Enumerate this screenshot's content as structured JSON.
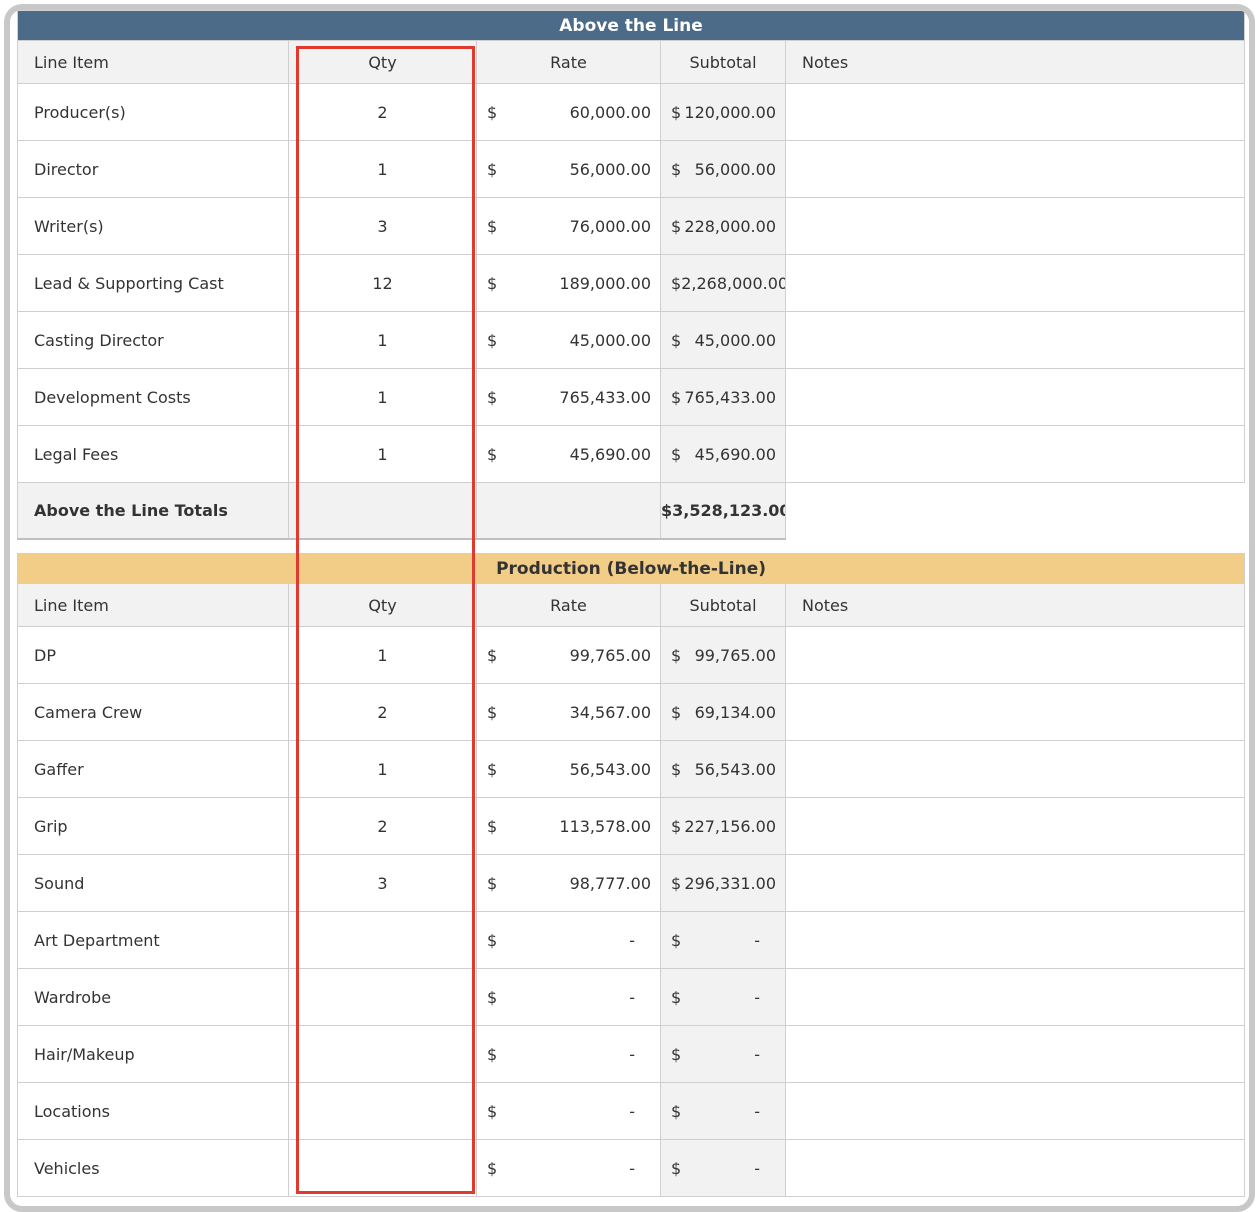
{
  "above": {
    "title": "Above the Line",
    "headers": {
      "item": "Line Item",
      "qty": "Qty",
      "rate": "Rate",
      "subtotal": "Subtotal",
      "notes": "Notes"
    },
    "currency": "$",
    "rows": [
      {
        "item": "Producer(s)",
        "qty": "2",
        "rate": "60,000.00",
        "subtotal": "120,000.00"
      },
      {
        "item": "Director",
        "qty": "1",
        "rate": "56,000.00",
        "subtotal": "56,000.00"
      },
      {
        "item": "Writer(s)",
        "qty": "3",
        "rate": "76,000.00",
        "subtotal": "228,000.00"
      },
      {
        "item": "Lead & Supporting Cast",
        "qty": "12",
        "rate": "189,000.00",
        "subtotal": "2,268,000.00"
      },
      {
        "item": "Casting Director",
        "qty": "1",
        "rate": "45,000.00",
        "subtotal": "45,000.00"
      },
      {
        "item": "Development Costs",
        "qty": "1",
        "rate": "765,433.00",
        "subtotal": "765,433.00"
      },
      {
        "item": "Legal Fees",
        "qty": "1",
        "rate": "45,690.00",
        "subtotal": "45,690.00"
      }
    ],
    "totals_label": "Above the Line Totals",
    "totals_value": "$3,528,123.00"
  },
  "production": {
    "title": "Production (Below-the-Line)",
    "headers": {
      "item": "Line Item",
      "qty": "Qty",
      "rate": "Rate",
      "subtotal": "Subtotal",
      "notes": "Notes"
    },
    "currency": "$",
    "rows": [
      {
        "item": "DP",
        "qty": "1",
        "rate": "99,765.00",
        "subtotal": "99,765.00"
      },
      {
        "item": "Camera Crew",
        "qty": "2",
        "rate": "34,567.00",
        "subtotal": "69,134.00"
      },
      {
        "item": "Gaffer",
        "qty": "1",
        "rate": "56,543.00",
        "subtotal": "56,543.00"
      },
      {
        "item": "Grip",
        "qty": "2",
        "rate": "113,578.00",
        "subtotal": "227,156.00"
      },
      {
        "item": "Sound",
        "qty": "3",
        "rate": "98,777.00",
        "subtotal": "296,331.00"
      },
      {
        "item": "Art Department",
        "qty": "",
        "rate": "-",
        "subtotal": "-"
      },
      {
        "item": "Wardrobe",
        "qty": "",
        "rate": "-",
        "subtotal": "-"
      },
      {
        "item": "Hair/Makeup",
        "qty": "",
        "rate": "-",
        "subtotal": "-"
      },
      {
        "item": "Locations",
        "qty": "",
        "rate": "-",
        "subtotal": "-"
      },
      {
        "item": "Vehicles",
        "qty": "",
        "rate": "-",
        "subtotal": "-"
      }
    ]
  },
  "colors": {
    "atl_banner": "#4c6b88",
    "btl_banner": "#f2cd87",
    "highlight": "#e03a2e"
  }
}
